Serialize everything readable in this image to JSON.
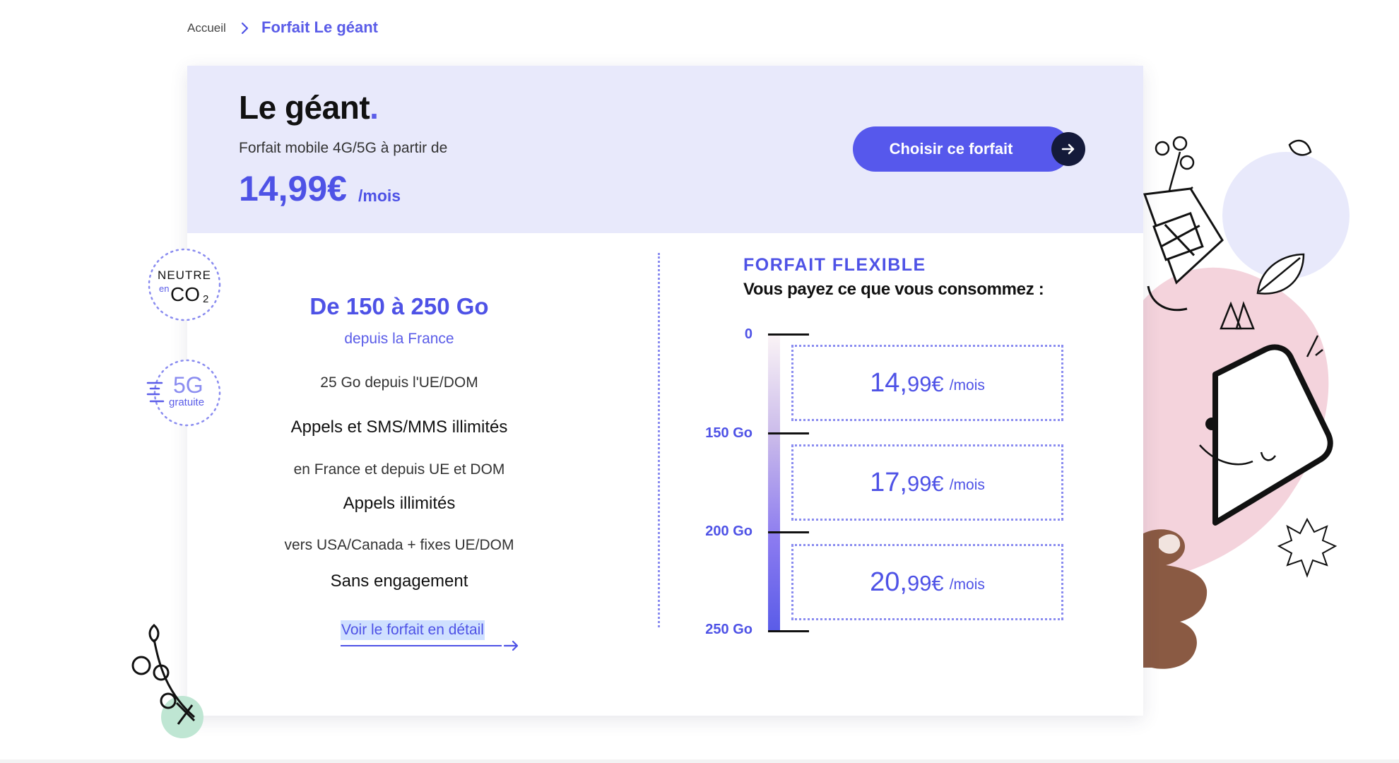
{
  "breadcrumb": {
    "home": "Accueil",
    "current": "Forfait Le géant"
  },
  "plan": {
    "title": "Le géant",
    "title_dot": ".",
    "subtitle": "Forfait mobile 4G/5G à partir de",
    "price": "14,99€",
    "price_unit": "/mois",
    "cta_label": "Choisir ce forfait"
  },
  "features": {
    "data_range": "De 150 à 250 Go",
    "data_sub": "depuis la France",
    "eu_data": "25 Go depuis l'UE/DOM",
    "calls_title": "Appels et SMS/MMS illimités",
    "calls_sub": "en France et depuis UE et DOM",
    "intl_title": "Appels illimités",
    "intl_sub": "vers USA/Canada + fixes UE/DOM",
    "commitment": "Sans engagement",
    "detail_link": "Voir le forfait en détail"
  },
  "flexible": {
    "title": "FORFAIT FLEXIBLE",
    "subtitle": "Vous payez ce que vous consommez :",
    "ticks": [
      "0",
      "150 Go",
      "200 Go",
      "250 Go"
    ],
    "tiers": [
      {
        "price_int": "14,",
        "price_dec": "99€",
        "unit": "/mois"
      },
      {
        "price_int": "17,",
        "price_dec": "99€",
        "unit": "/mois"
      },
      {
        "price_int": "20,",
        "price_dec": "99€",
        "unit": "/mois"
      }
    ]
  },
  "badges": {
    "co2_top": "NEUTRE",
    "co2_en": "en",
    "co2_main": "CO",
    "co2_sub": "2",
    "fiveg_main": "5G",
    "fiveg_sub": "gratuite"
  },
  "colors": {
    "accent": "#5a5ce8",
    "header_bg": "#e8e9fb",
    "button": "#5658ec",
    "dark": "#141a3a"
  }
}
